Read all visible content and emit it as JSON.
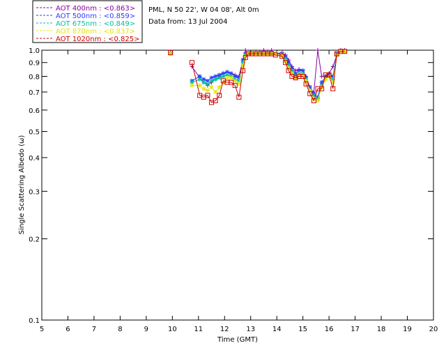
{
  "chart_data": {
    "type": "line",
    "xlabel": "Time (GMT)",
    "ylabel": "Single Scattering Albedo (ω)",
    "xlim": [
      5,
      20
    ],
    "ylim": [
      0.1,
      1.0
    ],
    "yscale": "log",
    "xticks": [
      5,
      6,
      7,
      8,
      9,
      10,
      11,
      12,
      13,
      14,
      15,
      16,
      17,
      18,
      19,
      20
    ],
    "yticks": [
      0.1,
      0.2,
      0.3,
      0.4,
      0.5,
      0.6,
      0.7,
      0.8,
      0.9,
      1.0
    ],
    "ytick_labels": [
      "0.1",
      "0.2",
      "0.3",
      "0.4",
      "0.5",
      "0.6",
      "0.7",
      "0.8",
      "0.9",
      "1.0"
    ],
    "grid": false,
    "legend_position": "top-left",
    "info_lines": [
      "PML, N 50 22', W 04 08', Alt 0m",
      "Data from: 13 Jul 2004"
    ],
    "x": [
      9.93,
      10.75,
      11.05,
      11.2,
      11.35,
      11.5,
      11.65,
      11.8,
      11.95,
      12.1,
      12.25,
      12.4,
      12.55,
      12.7,
      12.8,
      12.92,
      13.05,
      13.2,
      13.35,
      13.5,
      13.65,
      13.8,
      13.95,
      14.2,
      14.33,
      14.45,
      14.58,
      14.72,
      14.85,
      15.0,
      15.12,
      15.27,
      15.42,
      15.57,
      15.72,
      15.87,
      16.0,
      16.15,
      16.3,
      16.45,
      16.6
    ],
    "series": [
      {
        "name": "AOT  400nm : <0.863>",
        "color": "#8a009a",
        "marker": "+",
        "values": [
          0.98,
          0.87,
          0.79,
          0.76,
          0.74,
          0.76,
          0.78,
          0.8,
          0.82,
          0.83,
          0.82,
          0.81,
          0.8,
          0.92,
          1.0,
          0.97,
          0.97,
          0.98,
          0.98,
          1.0,
          0.98,
          1.0,
          0.97,
          0.98,
          0.96,
          0.92,
          0.87,
          0.84,
          0.85,
          0.84,
          0.8,
          0.72,
          0.7,
          1.0,
          0.8,
          0.8,
          0.82,
          0.87,
          0.96,
          1.0,
          1.0
        ]
      },
      {
        "name": "AOT  500nm : <0.859>",
        "color": "#2a3cff",
        "marker": "*",
        "values": [
          0.97,
          0.77,
          0.8,
          0.78,
          0.77,
          0.79,
          0.8,
          0.81,
          0.82,
          0.83,
          0.82,
          0.8,
          0.79,
          0.92,
          0.97,
          0.97,
          0.97,
          0.97,
          0.97,
          0.97,
          0.97,
          0.97,
          0.97,
          0.97,
          0.95,
          0.9,
          0.86,
          0.82,
          0.84,
          0.84,
          0.79,
          0.73,
          0.69,
          0.67,
          0.76,
          0.8,
          0.81,
          0.8,
          0.97,
          0.99,
          0.99
        ]
      },
      {
        "name": "AOT  675nm : <0.849>",
        "color": "#00c0a0",
        "marker": "*",
        "values": [
          0.97,
          0.76,
          0.78,
          0.76,
          0.75,
          0.77,
          0.78,
          0.79,
          0.8,
          0.81,
          0.8,
          0.78,
          0.77,
          0.9,
          0.96,
          0.97,
          0.97,
          0.97,
          0.97,
          0.97,
          0.97,
          0.97,
          0.97,
          0.96,
          0.93,
          0.88,
          0.84,
          0.8,
          0.82,
          0.82,
          0.78,
          0.71,
          0.68,
          0.66,
          0.74,
          0.79,
          0.8,
          0.78,
          0.96,
          0.99,
          0.99
        ]
      },
      {
        "name": "AOT  870nm : <0.837>",
        "color": "#e6e600",
        "marker": "*",
        "values": [
          0.97,
          0.74,
          0.74,
          0.72,
          0.71,
          0.73,
          0.7,
          0.73,
          0.76,
          0.79,
          0.79,
          0.77,
          0.75,
          0.88,
          0.95,
          0.97,
          0.97,
          0.97,
          0.97,
          0.97,
          0.97,
          0.97,
          0.97,
          0.96,
          0.91,
          0.86,
          0.82,
          0.79,
          0.81,
          0.81,
          0.77,
          0.71,
          0.66,
          0.65,
          0.73,
          0.78,
          0.8,
          0.76,
          0.96,
          0.99,
          0.99
        ]
      },
      {
        "name": "AOT 1020nm : <0.825>",
        "color": "#d00000",
        "marker": "square",
        "values": [
          0.98,
          0.9,
          0.68,
          0.67,
          0.68,
          0.64,
          0.65,
          0.68,
          0.77,
          0.76,
          0.76,
          0.74,
          0.67,
          0.84,
          0.94,
          0.97,
          0.97,
          0.97,
          0.97,
          0.97,
          0.97,
          0.97,
          0.96,
          0.95,
          0.9,
          0.84,
          0.8,
          0.79,
          0.8,
          0.8,
          0.75,
          0.69,
          0.65,
          0.72,
          0.72,
          0.81,
          0.81,
          0.72,
          0.97,
          0.99,
          0.99
        ]
      }
    ]
  }
}
